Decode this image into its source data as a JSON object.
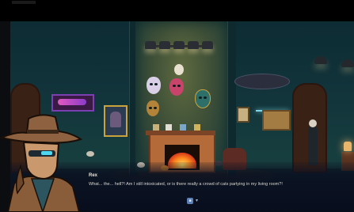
{
  "dialogue": {
    "speaker": "Rex",
    "line": "What... the... hell?! Am I still intoxicated, or is there really a crowd of cats partying in my living room?!"
  },
  "colors": {
    "wall": "#12343b",
    "alcove_glow": "#5e6a3f",
    "fire": "#ff8a1f",
    "dialogue_bg": "#0a1022",
    "accent_neon": "#7fd6e8"
  },
  "icons": {
    "continue": "gamepad-button-icon",
    "advance": "chevron-down-icon"
  }
}
